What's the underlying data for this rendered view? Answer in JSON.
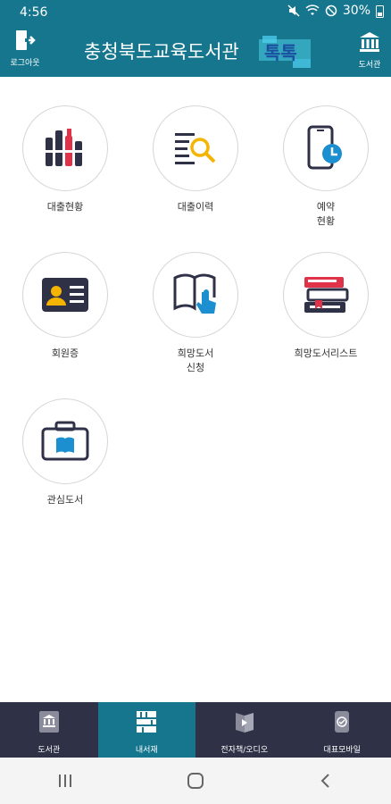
{
  "status": {
    "time": "4:56",
    "battery": "30%"
  },
  "header": {
    "logout_label": "로그아웃",
    "title": "충청북도교육도서관",
    "brand": "톡톡",
    "library_label": "도서관"
  },
  "menu": [
    {
      "label": "대출현황"
    },
    {
      "label": "대출이력"
    },
    {
      "label": "예약\n현황"
    },
    {
      "label": "회원증"
    },
    {
      "label": "희망도서\n신청"
    },
    {
      "label": "희망도서리스트"
    },
    {
      "label": "관심도서"
    }
  ],
  "tabs": [
    {
      "label": "도서관"
    },
    {
      "label": "내서재"
    },
    {
      "label": "전자책/오디오"
    },
    {
      "label": "대표모바일"
    }
  ],
  "colors": {
    "primary": "#16768e",
    "tabbar": "#2f3147",
    "accent_red": "#e0334a",
    "accent_blue": "#1c8fd0",
    "accent_yellow": "#f4b400"
  }
}
